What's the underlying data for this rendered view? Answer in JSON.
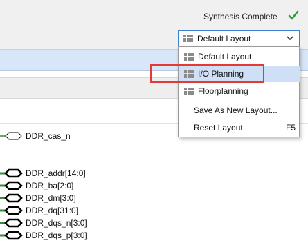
{
  "header": {
    "status_text": "Synthesis Complete",
    "status_icon": "checkmark-icon",
    "status_color": "#2e9a3a"
  },
  "layout_selector": {
    "selected": "Default Layout",
    "accent": "#3c7fd4"
  },
  "layout_menu": {
    "items": [
      {
        "label": "Default Layout",
        "icon": "layout-grid-icon"
      },
      {
        "label": "I/O Planning",
        "icon": "layout-grid-icon"
      },
      {
        "label": "Floorplanning",
        "icon": "layout-grid-icon"
      },
      {
        "label": "Save As New Layout..."
      },
      {
        "label": "Reset Layout",
        "shortcut": "F5"
      }
    ],
    "selected_label": "I/O Planning",
    "selected_bg": "#cfe0f6"
  },
  "schematic": {
    "ports": [
      "DDR_cas_n",
      "DDR_addr[14:0]",
      "DDR_ba[2:0]",
      "DDR_dm[3:0]",
      "DDR_dq[31:0]",
      "DDR_dqs_n[3:0]",
      "DDR_dqs_p[3:0]"
    ],
    "bus_color": "#000000",
    "wire_color": "#3a8a3a"
  }
}
